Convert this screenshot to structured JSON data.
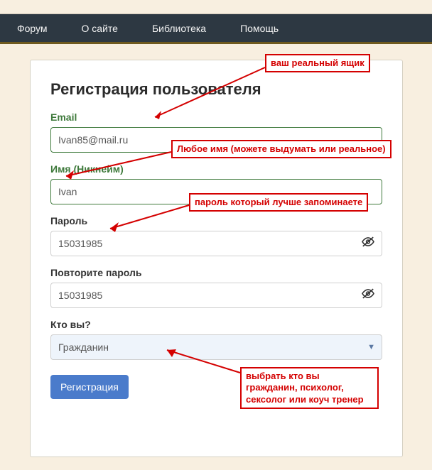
{
  "nav": {
    "items": [
      "Форум",
      "О сайте",
      "Библиотека",
      "Помощь"
    ]
  },
  "form": {
    "title": "Регистрация пользователя",
    "email_label": "Email",
    "email_value": "Ivan85@mail.ru",
    "nickname_label": "Имя (Никнейм)",
    "nickname_value": "Ivan",
    "password_label": "Пароль",
    "password_value": "15031985",
    "password2_label": "Повторите пароль",
    "password2_value": "15031985",
    "who_label": "Кто вы?",
    "who_value": "Гражданин",
    "submit_label": "Регистрация"
  },
  "annotations": {
    "email": "ваш реальный ящик",
    "nickname": "Любое имя (можете выдумать или реальное)",
    "password": "пароль который лучше запоминаете",
    "who": "выбрать кто вы гражданин, психолог, сексолог или коуч тренер"
  }
}
